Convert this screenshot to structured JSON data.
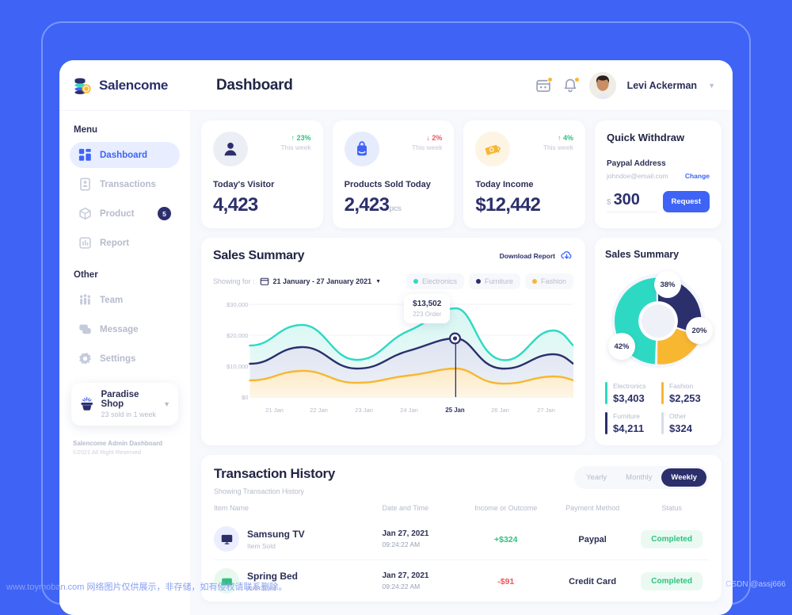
{
  "theme": {
    "background": "#3e63f5",
    "accent": "#3e63f5",
    "navy": "#2b2f6b",
    "teal": "#2ed9c3",
    "orange": "#f7b731",
    "green": "#2ec27e",
    "red": "#f2545b"
  },
  "brand": {
    "name": "Salencome",
    "logo_icon": "coins-stack-icon"
  },
  "header": {
    "page_title": "Dashboard",
    "calendar_icon": "calendar-icon",
    "bell_icon": "bell-icon",
    "user_name": "Levi Ackerman",
    "caret_icon": "chevron-down-icon"
  },
  "sidebar": {
    "menu_label": "Menu",
    "other_label": "Other",
    "menu_items": [
      {
        "label": "Dashboard",
        "icon": "grid-icon",
        "active": true,
        "badge": ""
      },
      {
        "label": "Transactions",
        "icon": "receipt-icon",
        "active": false,
        "badge": ""
      },
      {
        "label": "Product",
        "icon": "box-icon",
        "active": false,
        "badge": "5"
      },
      {
        "label": "Report",
        "icon": "report-icon",
        "active": false,
        "badge": ""
      }
    ],
    "other_items": [
      {
        "label": "Team",
        "icon": "team-icon",
        "active": false,
        "badge": ""
      },
      {
        "label": "Message",
        "icon": "message-icon",
        "active": false,
        "badge": ""
      },
      {
        "label": "Settings",
        "icon": "gear-icon",
        "active": false,
        "badge": ""
      }
    ],
    "shop": {
      "name": "Paradise Shop",
      "sub": "23 sold in 1 week",
      "icon": "shop-cart-icon",
      "caret_icon": "chevron-down-icon"
    },
    "footer_line1": "Salencome Admin Dashboard",
    "footer_line2": "©2021 All Right Reserved"
  },
  "stats": [
    {
      "name": "Today's Visitor",
      "value": "4,423",
      "unit": "",
      "trend_value": "23%",
      "trend_label": "This week",
      "trend_dir": "up",
      "icon": "user-icon",
      "icon_bg": "#eceef5",
      "icon_color": "#2b2f6b"
    },
    {
      "name": "Products Sold Today",
      "value": "2,423",
      "unit": "pcs",
      "trend_value": "2%",
      "trend_label": "This week",
      "trend_dir": "down",
      "icon": "shopping-bag-icon",
      "icon_bg": "#e7ecfd",
      "icon_color": "#3e63f5"
    },
    {
      "name": "Today Income",
      "value": "$12,442",
      "unit": "",
      "trend_value": "4%",
      "trend_label": "This week",
      "trend_dir": "up",
      "icon": "money-icon",
      "icon_bg": "#fdf4e3",
      "icon_color": "#f7b731"
    }
  ],
  "withdraw": {
    "title": "Quick Withdraw",
    "field_label": "Paypal Address",
    "email": "johndoe@email.com",
    "change_label": "Change",
    "currency": "$",
    "amount": "300",
    "button_label": "Request"
  },
  "sales_summary": {
    "title": "Sales Summary",
    "download_label": "Download Report",
    "download_icon": "cloud-download-icon",
    "showing_label": "Showing for :",
    "calendar_icon": "calendar-icon",
    "date_range": "21 January - 27 January 2021",
    "caret_icon": "chevron-down-icon",
    "legends": [
      {
        "label": "Electronics",
        "color": "#2ed9c3"
      },
      {
        "label": "Furniture",
        "color": "#2b2f6b"
      },
      {
        "label": "Fashion",
        "color": "#f7b731"
      }
    ],
    "tooltip": {
      "value": "$13,502",
      "sub": "223 Order"
    }
  },
  "chart_data": [
    {
      "type": "area",
      "title": "Sales Summary",
      "xlabel": "",
      "ylabel": "",
      "ylim": [
        0,
        30000
      ],
      "ytick_labels": [
        "$0",
        "$10,000",
        "$20,000",
        "$30,000"
      ],
      "ytick_values": [
        0,
        10000,
        20000,
        30000
      ],
      "categories": [
        "21 Jan",
        "22 Jan",
        "23 Jan",
        "24 Jan",
        "25 Jan",
        "26 Jan",
        "27 Jan"
      ],
      "highlight_category": "25 Jan",
      "grid": false,
      "legend_position": "top-right",
      "series": [
        {
          "name": "Electronics",
          "color": "#2ed9c3",
          "values": [
            16500,
            22500,
            13800,
            19800,
            26800,
            13400,
            19200
          ]
        },
        {
          "name": "Furniture",
          "color": "#2b2f6b",
          "values": [
            10800,
            15300,
            9600,
            13200,
            17800,
            9200,
            12900
          ]
        },
        {
          "name": "Fashion",
          "color": "#f7b731",
          "values": [
            5400,
            7800,
            4800,
            6400,
            9200,
            4500,
            6600
          ]
        }
      ]
    },
    {
      "type": "pie",
      "title": "Sales Summary",
      "labels": [
        "Electronics",
        "Furniture",
        "Fashion",
        "Other"
      ],
      "percent_labels": [
        "42%",
        "38%",
        "20%"
      ],
      "values": [
        42,
        38,
        20
      ],
      "amounts": [
        "$3,403",
        "$4,211",
        "$2,253",
        "$324"
      ],
      "colors": [
        "#2ed9c3",
        "#2b2f6b",
        "#f7b731",
        "#d7dcea"
      ],
      "legend_position": "bottom"
    }
  ],
  "donut_panel": {
    "title": "Sales Summary",
    "percents": [
      {
        "value": "38%",
        "top": 10,
        "left": 60
      },
      {
        "value": "42%",
        "top": 88,
        "left": 8
      },
      {
        "value": "20%",
        "top": 72,
        "left": 104
      }
    ],
    "legends": [
      {
        "name": "Electronics",
        "amount": "$3,403",
        "color": "#2ed9c3"
      },
      {
        "name": "Fashion",
        "amount": "$2,253",
        "color": "#f7b731"
      },
      {
        "name": "Furniture",
        "amount": "$4,211",
        "color": "#2b2f6b"
      },
      {
        "name": "Other",
        "amount": "$324",
        "color": "#d7dcea"
      }
    ]
  },
  "transactions": {
    "title": "Transaction History",
    "subtitle": "Showing Transaction History",
    "toggles": [
      {
        "label": "Yearly",
        "active": false
      },
      {
        "label": "Monthly",
        "active": false
      },
      {
        "label": "Weekly",
        "active": true
      }
    ],
    "columns": [
      "Item Name",
      "Date and Time",
      "Income or Outcome",
      "Payment Method",
      "Status"
    ],
    "rows": [
      {
        "item": "Samsung TV",
        "item_sub": "Item Sold",
        "icon": "monitor-icon",
        "date": "Jan 27, 2021",
        "time": "09:24:22 AM",
        "amount": "+$324",
        "amount_type": "income",
        "payment": "Paypal",
        "status": "Completed"
      },
      {
        "item": "Spring Bed",
        "item_sub": "Item Sold",
        "icon": "bed-icon",
        "date": "Jan 27, 2021",
        "time": "09:24:22 AM",
        "amount": "-$91",
        "amount_type": "outcome",
        "payment": "Credit Card",
        "status": "Completed"
      }
    ]
  },
  "watermark": {
    "left": "www.toymoban.com 网络图片仅供展示，非存储，如有侵权请联系删除。",
    "right": "CSDN @assj666"
  }
}
